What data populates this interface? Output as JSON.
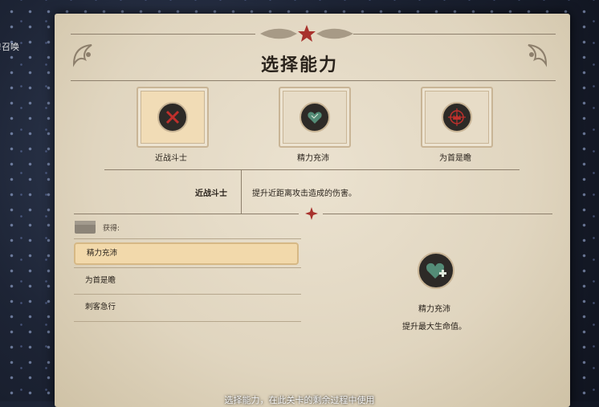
{
  "edge_text": "召唤!",
  "title": "选择能力",
  "abilities": [
    {
      "label": "近战斗士",
      "icon": "crossed-swords-x-icon"
    },
    {
      "label": "精力充沛",
      "icon": "heart-icon"
    },
    {
      "label": "为首是瞻",
      "icon": "crosshair-crown-icon"
    }
  ],
  "description": {
    "name": "近战斗士",
    "text": "提升近距离攻击造成的伤害。"
  },
  "list": {
    "header": "获得:",
    "items": [
      "精力充沛",
      "为首是瞻",
      "刺客急行"
    ]
  },
  "detail": {
    "name": "精力充沛",
    "text": "提升最大生命值。",
    "icon": "heart-plus-icon"
  },
  "subtitle": "选择能力，在此关卡的剩余过程中使用",
  "colors": {
    "parchment": "#e0d5bf",
    "ink": "#2a231c",
    "accent_red": "#c0302c",
    "highlight": "#f2d9ab"
  }
}
